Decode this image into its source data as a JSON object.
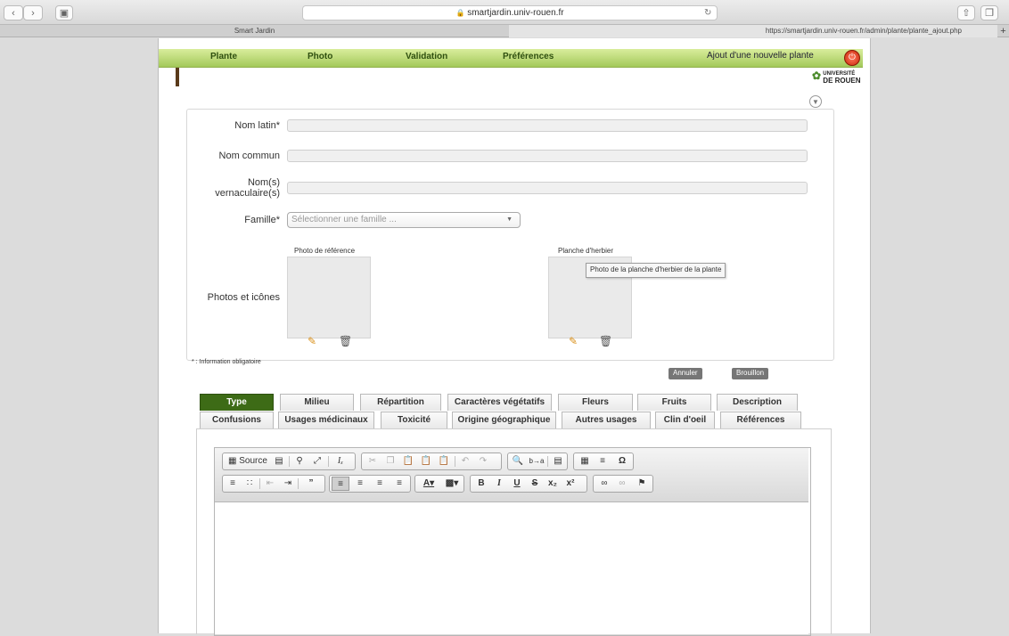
{
  "browser": {
    "url_display": "smartjardin.univ-rouen.fr",
    "tabs": [
      {
        "title": "Smart Jardin"
      },
      {
        "title": "https://smartjardin.univ-rouen.fr/admin/plante/plante_ajout.php"
      }
    ]
  },
  "nav": {
    "items": [
      "Plante",
      "Photo",
      "Validation",
      "Préférences"
    ],
    "add_plant": "Ajout d'une nouvelle plante",
    "university_top": "UNIVERSITÉ",
    "university_bottom": "DE ROUEN"
  },
  "form": {
    "nom_latin_label": "Nom latin*",
    "nom_commun_label": "Nom commun",
    "vernaculaire_label_1": "Nom(s)",
    "vernaculaire_label_2": "vernaculaire(s)",
    "famille_label": "Famille*",
    "famille_placeholder": "Sélectionner une famille ...",
    "photos_label": "Photos et icônes",
    "photo_reference_caption": "Photo de référence",
    "planche_caption": "Planche d'herbier",
    "tooltip": "Photo de la planche d'herbier de la plante",
    "required_note": "* : Information obligatoire",
    "cancel_button": "Annuler",
    "draft_button": "Brouillon"
  },
  "tabs_row1": [
    "Type",
    "Milieu",
    "Répartition",
    "Caractères végétatifs",
    "Fleurs",
    "Fruits",
    "Description"
  ],
  "tabs_row2": [
    "Confusions",
    "Usages médicinaux",
    "Toxicité",
    "Origine géographique",
    "Autres usages",
    "Clin d'oeil",
    "Références"
  ],
  "active_tab": "Type",
  "editor": {
    "source_label": "Source"
  },
  "colors": {
    "nav_green": "#a3c95a",
    "active_tab": "#3d6b16",
    "power_red": "#c92508"
  }
}
